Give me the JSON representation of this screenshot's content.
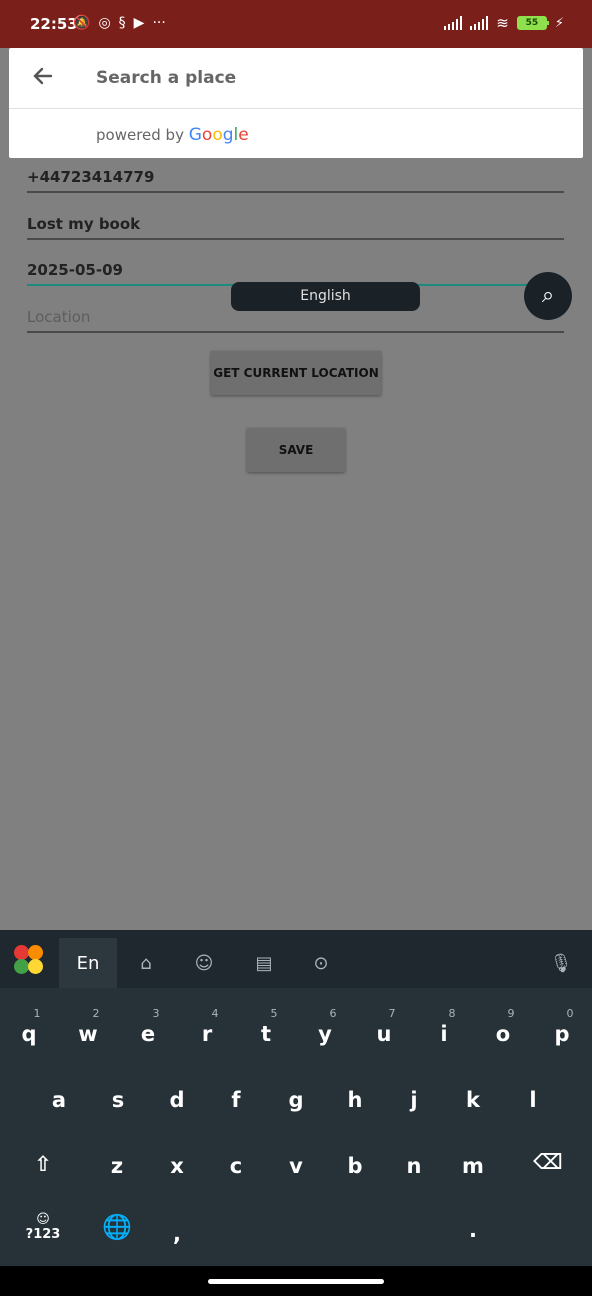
{
  "status_bar": {
    "time": "22:53",
    "battery": "55"
  },
  "search": {
    "placeholder": "Search a place",
    "powered_by": "powered by",
    "google": [
      "G",
      "o",
      "o",
      "g",
      "l",
      "e"
    ]
  },
  "form": {
    "phone": "+44723414779",
    "description": "Lost my book",
    "date": "2025-05-09",
    "location_placeholder": "Location",
    "get_location_label": "GET CURRENT LOCATION",
    "save_label": "SAVE"
  },
  "keyboard": {
    "lang_tab": "En",
    "row1": [
      "q",
      "w",
      "e",
      "r",
      "t",
      "y",
      "u",
      "i",
      "o",
      "p"
    ],
    "row1_numbers": [
      "1",
      "2",
      "3",
      "4",
      "5",
      "6",
      "7",
      "8",
      "9",
      "0"
    ],
    "row2": [
      "a",
      "s",
      "d",
      "f",
      "g",
      "h",
      "j",
      "k",
      "l"
    ],
    "row3": [
      "z",
      "x",
      "c",
      "v",
      "b",
      "n",
      "m"
    ],
    "sym_label": "?123",
    "space_label": "English",
    "comma": ",",
    "period": "."
  },
  "colors": {
    "status_bar": "#7a1f1a",
    "accent_underline": "#1d8a80"
  }
}
